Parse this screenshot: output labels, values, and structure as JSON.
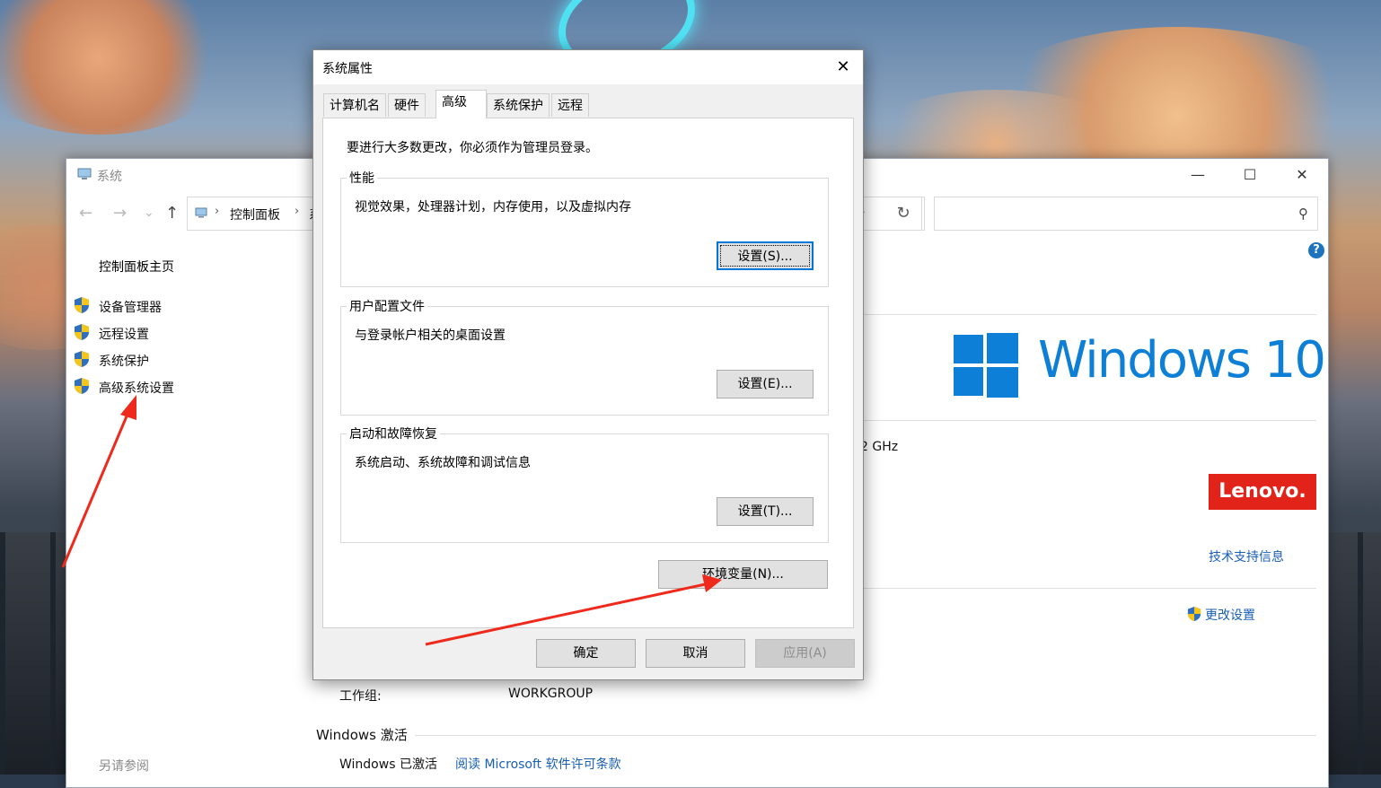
{
  "system_window": {
    "title": "系统",
    "window_controls": {
      "minimize": "—",
      "maximize": "☐",
      "close": "✕"
    },
    "nav": {
      "back": "←",
      "forward": "→",
      "recent": "⌄",
      "up": "↑"
    },
    "breadcrumb": [
      "控制面板",
      "系"
    ],
    "breadcrumb_sep": "›",
    "refresh": "↻",
    "dropdown": "⌄",
    "search_placeholder": "",
    "search_glyph": "⚲",
    "help": "?",
    "sidebar": {
      "home": "控制面板主页",
      "items": [
        {
          "label": "设备管理器"
        },
        {
          "label": "远程设置"
        },
        {
          "label": "系统保护"
        },
        {
          "label": "高级系统设置"
        }
      ],
      "see_also": "另请参阅"
    },
    "windows_edition_text": "Windows 10",
    "processor_fragment": "2 GHz",
    "oem_logo": "Lenovo.",
    "support_link": "技术支持信息",
    "change_settings_link": "更改设置",
    "workgroup_label": "工作组:",
    "workgroup_value": "WORKGROUP",
    "activation_title": "Windows 激活",
    "activated_text": "Windows 已激活",
    "license_link": "阅读 Microsoft 软件许可条款"
  },
  "dialog": {
    "title": "系统属性",
    "close": "✕",
    "tabs": [
      {
        "label": "计算机名"
      },
      {
        "label": "硬件"
      },
      {
        "label": "高级",
        "active": true
      },
      {
        "label": "系统保护"
      },
      {
        "label": "远程"
      }
    ],
    "admin_note": "要进行大多数更改，你必须作为管理员登录。",
    "groups": {
      "performance": {
        "title": "性能",
        "desc": "视觉效果，处理器计划，内存使用，以及虚拟内存",
        "button": "设置(S)..."
      },
      "user_profiles": {
        "title": "用户配置文件",
        "desc": "与登录帐户相关的桌面设置",
        "button": "设置(E)..."
      },
      "startup_recovery": {
        "title": "启动和故障恢复",
        "desc": "系统启动、系统故障和调试信息",
        "button": "设置(T)..."
      }
    },
    "env_button": "环境变量(N)...",
    "ok_button": "确定",
    "cancel_button": "取消",
    "apply_button": "应用(A)"
  },
  "colors": {
    "accent": "#0078d7",
    "link": "#1a5fb4",
    "annotation": "#ee2a1c",
    "win10_blue": "#0d7fd6",
    "lenovo_red": "#e2231a"
  }
}
